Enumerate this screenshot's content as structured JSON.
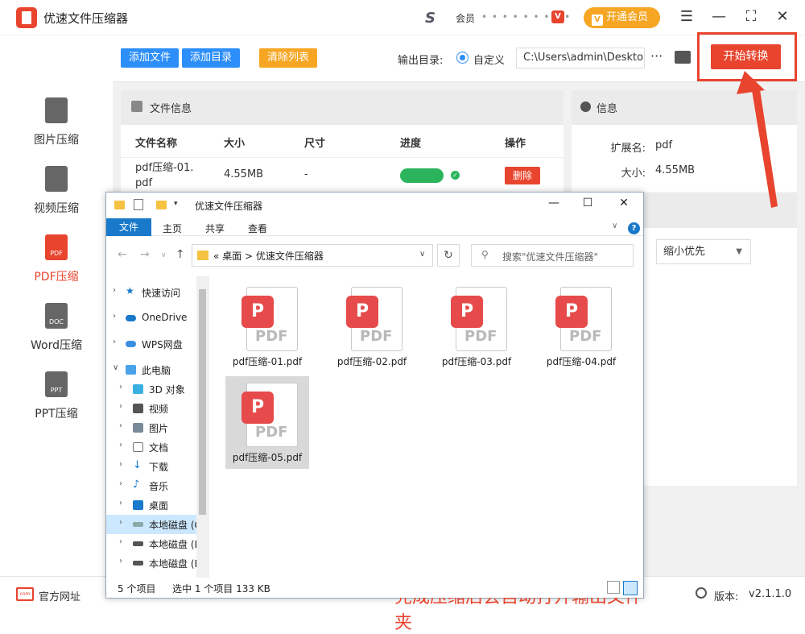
{
  "app": {
    "title": "优速文件压缩器",
    "member_label": "会员",
    "member_name": "• • • • • • • • •",
    "open_vip": "开通会员"
  },
  "sidebar": {
    "items": [
      {
        "label": "图片压缩",
        "icon": "image-file-icon"
      },
      {
        "label": "视频压缩",
        "icon": "video-file-icon"
      },
      {
        "label": "PDF压缩",
        "icon": "pdf-file-icon",
        "tag": "PDF"
      },
      {
        "label": "Word压缩",
        "icon": "doc-file-icon",
        "tag": "DOC"
      },
      {
        "label": "PPT压缩",
        "icon": "ppt-file-icon",
        "tag": "PPT"
      }
    ]
  },
  "toolbar": {
    "add_file": "添加文件",
    "add_dir": "添加目录",
    "clear_list": "清除列表",
    "output_label": "输出目录:",
    "radio_label": "自定义",
    "path": "C:\\Users\\admin\\Desktop",
    "more": "···",
    "start": "开始转换"
  },
  "file_info": {
    "title": "文件信息",
    "columns": [
      "文件名称",
      "大小",
      "尺寸",
      "进度",
      "操作"
    ],
    "rows": [
      {
        "name": "pdf压缩-01.\npdf",
        "size": "4.55MB",
        "dims": "-",
        "action": "删除"
      }
    ]
  },
  "info": {
    "title": "信息",
    "ext_label": "扩展名:",
    "ext_value": "pdf",
    "size_label": "大小:",
    "size_value": "4.55MB",
    "mode": "缩小优先"
  },
  "bottom": {
    "site": "官方网址",
    "version_label": "版本:",
    "version": "v2.1.1.0"
  },
  "explorer": {
    "title": "优速文件压缩器",
    "tabs": [
      "文件",
      "主页",
      "共享",
      "查看"
    ],
    "breadcrumb": [
      "«",
      "桌面",
      ">",
      "优速文件压缩器"
    ],
    "search_placeholder": "搜索\"优速文件压缩器\"",
    "nav": [
      "快速访问",
      "OneDrive",
      "WPS网盘",
      "此电脑",
      "3D 对象",
      "视频",
      "图片",
      "文档",
      "下载",
      "音乐",
      "桌面",
      "本地磁盘 (C:)",
      "本地磁盘 (D:)",
      "本地磁盘 (E:)"
    ],
    "files": [
      "pdf压缩-01.pdf",
      "pdf压缩-02.pdf",
      "pdf压缩-03.pdf",
      "pdf压缩-04.pdf",
      "pdf压缩-05.pdf"
    ],
    "status_count": "5 个项目",
    "status_sel": "选中 1 个项目  133 KB"
  },
  "annotation": {
    "caption": "完成压缩后会自动打开输出文件夹",
    "color": "#e8442e"
  }
}
